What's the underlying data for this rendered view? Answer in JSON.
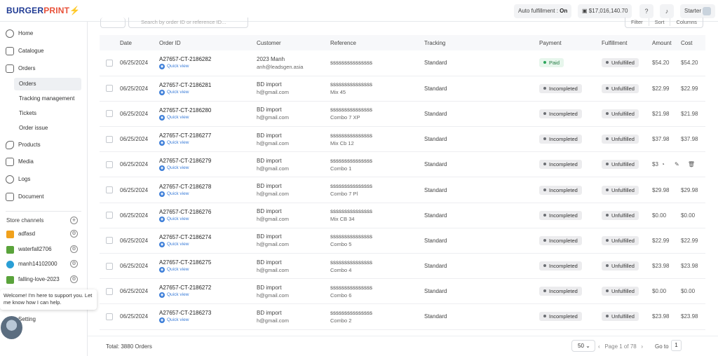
{
  "brand": {
    "part1": "BURGER",
    "part2": "PRINT"
  },
  "topbar": {
    "auto_fulfillment_label": "Auto fulfillment :",
    "auto_fulfillment_value": "On",
    "balance": "$17,016,140.70",
    "help_icon": "question-icon",
    "bell_icon": "bell-icon",
    "plan": "Starter"
  },
  "sidebar": {
    "items": [
      {
        "label": "Home",
        "icon": "home-icon"
      },
      {
        "label": "Catalogue",
        "icon": "catalogue-icon"
      },
      {
        "label": "Orders",
        "icon": "orders-icon"
      },
      {
        "label": "Products",
        "icon": "products-icon"
      },
      {
        "label": "Media",
        "icon": "media-icon"
      },
      {
        "label": "Logs",
        "icon": "logs-icon"
      },
      {
        "label": "Document",
        "icon": "document-icon"
      }
    ],
    "order_subitems": [
      "Orders",
      "Tracking management",
      "Tickets",
      "Order issue"
    ],
    "store_channels_title": "Store channels",
    "stores": [
      {
        "name": "adfasd",
        "color": "#f1a11c"
      },
      {
        "name": "waterfall2706",
        "color": "#5aa33b"
      },
      {
        "name": "manh14102000",
        "color": "#2a9fd6"
      },
      {
        "name": "falling-love-2023",
        "color": "#5aa33b"
      }
    ],
    "setting_label": "Setting"
  },
  "support_tooltip": "Welcome! I'm here to support you. Let me know how I can help.",
  "search": {
    "placeholder": "Search by order ID or reference ID..."
  },
  "toolbar": {
    "filter": "Filter",
    "sort": "Sort",
    "columns": "Columns"
  },
  "table": {
    "columns": [
      "Date",
      "Order ID",
      "Customer",
      "Reference",
      "Tracking",
      "Payment",
      "Fulfillment",
      "Amount",
      "Cost"
    ],
    "quick_view_label": "Quick view",
    "rows": [
      {
        "date": "06/25/2024",
        "order_id": "A27657-CT-2186282",
        "customer": "2023 Manh",
        "email": "anh@leadsgen.asia",
        "reference": "sssssssssssssss",
        "ref_sub": "",
        "tracking": "Standard",
        "payment": "Paid",
        "fulfillment": "Unfulfilled",
        "amount": "$54.20",
        "cost": "$54.20"
      },
      {
        "date": "06/25/2024",
        "order_id": "A27657-CT-2186281",
        "customer": "BD import",
        "email": "h@gmail.com",
        "reference": "sssssssssssssss",
        "ref_sub": "Mix 45",
        "tracking": "Standard",
        "payment": "Incompleted",
        "fulfillment": "Unfulfilled",
        "amount": "$22.99",
        "cost": "$22.99"
      },
      {
        "date": "06/25/2024",
        "order_id": "A27657-CT-2186280",
        "customer": "BD import",
        "email": "h@gmail.com",
        "reference": "sssssssssssssss",
        "ref_sub": "Combo 7 XP",
        "tracking": "Standard",
        "payment": "Incompleted",
        "fulfillment": "Unfulfilled",
        "amount": "$21.98",
        "cost": "$21.98"
      },
      {
        "date": "06/25/2024",
        "order_id": "A27657-CT-2186277",
        "customer": "BD import",
        "email": "h@gmail.com",
        "reference": "sssssssssssssss",
        "ref_sub": "Mix Cb 12",
        "tracking": "Standard",
        "payment": "Incompleted",
        "fulfillment": "Unfulfilled",
        "amount": "$37.98",
        "cost": "$37.98"
      },
      {
        "date": "06/25/2024",
        "order_id": "A27657-CT-2186279",
        "customer": "BD import",
        "email": "h@gmail.com",
        "reference": "sssssssssssssss",
        "ref_sub": "Combo 1",
        "tracking": "Standard",
        "payment": "Incompleted",
        "fulfillment": "Unfulfilled",
        "amount": "$3",
        "cost": "",
        "hover": true
      },
      {
        "date": "06/25/2024",
        "order_id": "A27657-CT-2186278",
        "customer": "BD import",
        "email": "h@gmail.com",
        "reference": "sssssssssssssss",
        "ref_sub": "Combo 7 Pl",
        "tracking": "Standard",
        "payment": "Incompleted",
        "fulfillment": "Unfulfilled",
        "amount": "$29.98",
        "cost": "$29.98"
      },
      {
        "date": "06/25/2024",
        "order_id": "A27657-CT-2186276",
        "customer": "BD import",
        "email": "h@gmail.com",
        "reference": "sssssssssssssss",
        "ref_sub": "Mix CB 34",
        "tracking": "Standard",
        "payment": "Incompleted",
        "fulfillment": "Unfulfilled",
        "amount": "$0.00",
        "cost": "$0.00"
      },
      {
        "date": "06/25/2024",
        "order_id": "A27657-CT-2186274",
        "customer": "BD import",
        "email": "h@gmail.com",
        "reference": "sssssssssssssss",
        "ref_sub": "Combo 5",
        "tracking": "Standard",
        "payment": "Incompleted",
        "fulfillment": "Unfulfilled",
        "amount": "$22.99",
        "cost": "$22.99"
      },
      {
        "date": "06/25/2024",
        "order_id": "A27657-CT-2186275",
        "customer": "BD import",
        "email": "h@gmail.com",
        "reference": "sssssssssssssss",
        "ref_sub": "Combo 4",
        "tracking": "Standard",
        "payment": "Incompleted",
        "fulfillment": "Unfulfilled",
        "amount": "$23.98",
        "cost": "$23.98"
      },
      {
        "date": "06/25/2024",
        "order_id": "A27657-CT-2186272",
        "customer": "BD import",
        "email": "h@gmail.com",
        "reference": "sssssssssssssss",
        "ref_sub": "Combo 6",
        "tracking": "Standard",
        "payment": "Incompleted",
        "fulfillment": "Unfulfilled",
        "amount": "$0.00",
        "cost": "$0.00"
      },
      {
        "date": "06/25/2024",
        "order_id": "A27657-CT-2186273",
        "customer": "BD import",
        "email": "h@gmail.com",
        "reference": "sssssssssssssss",
        "ref_sub": "Combo 2",
        "tracking": "Standard",
        "payment": "Incompleted",
        "fulfillment": "Unfulfilled",
        "amount": "$23.98",
        "cost": "$23.98"
      }
    ]
  },
  "footer": {
    "total": "Total: 3880 Orders",
    "per_page": "50",
    "page_info": "Page 1 of 78",
    "goto_label": "Go to",
    "goto_value": "1"
  }
}
